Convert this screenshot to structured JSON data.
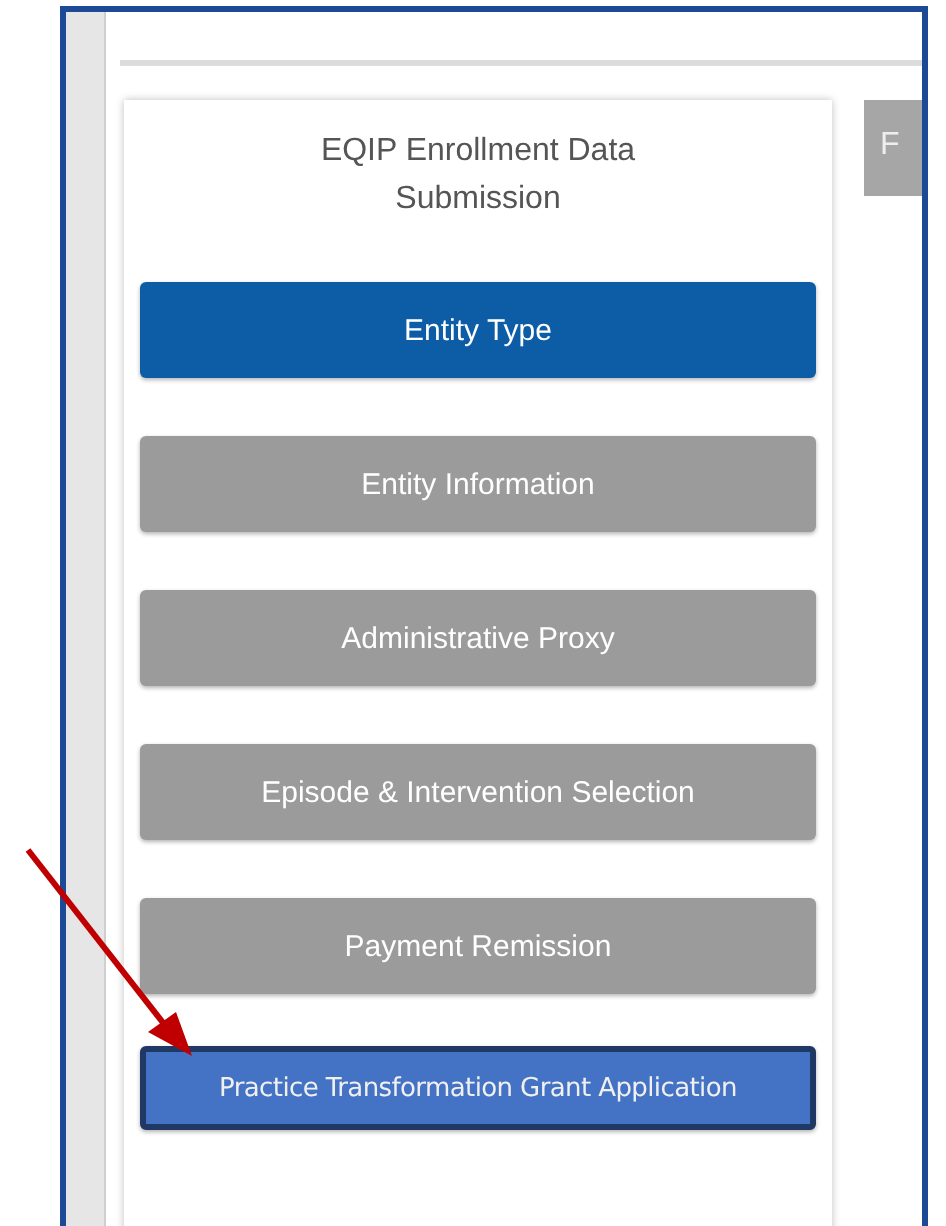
{
  "panel": {
    "title": "EQIP Enrollment Data Submission",
    "steps": [
      {
        "label": "Entity Type",
        "kind": "step",
        "selected": true
      },
      {
        "label": "Entity Information",
        "kind": "step",
        "selected": false
      },
      {
        "label": "Administrative Proxy",
        "kind": "step",
        "selected": false
      },
      {
        "label": "Episode & Intervention Selection",
        "kind": "step",
        "selected": false
      },
      {
        "label": "Payment Remission",
        "kind": "step",
        "selected": false
      },
      {
        "label": "Practice Transformation Grant Application",
        "kind": "callout",
        "selected": false
      }
    ]
  },
  "side_tab": {
    "label": "F"
  }
}
